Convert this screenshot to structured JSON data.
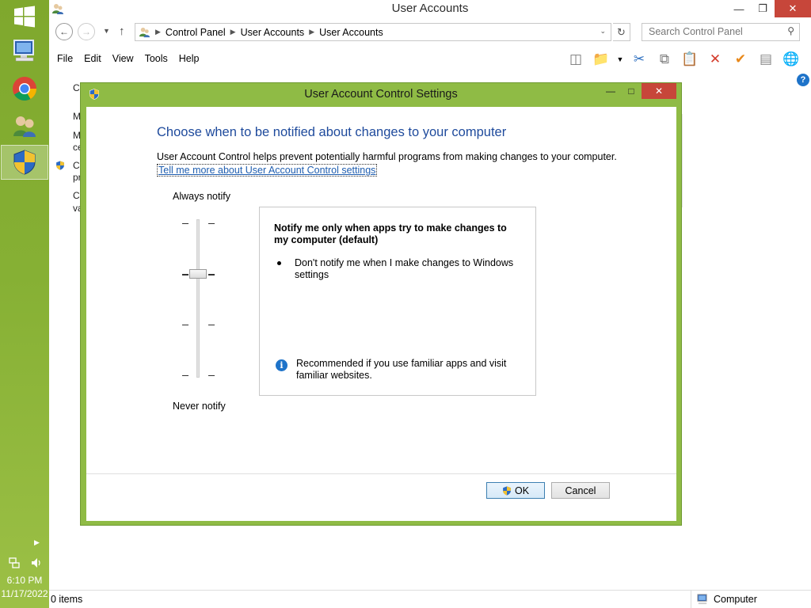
{
  "taskbar": {
    "time": "6:10 PM",
    "date": "11/17/2022",
    "pinned": [
      "computer-icon",
      "chrome-icon",
      "user-accounts-icon",
      "uac-shield-icon"
    ]
  },
  "explorer": {
    "title": "User Accounts",
    "breadcrumb": [
      "Control Panel",
      "User Accounts",
      "User Accounts"
    ],
    "search_placeholder": "Search Control Panel",
    "menu": [
      "File",
      "Edit",
      "View",
      "Tools",
      "Help"
    ],
    "background_fragments": [
      "C",
      "M",
      "M",
      "ce",
      "C",
      "pr",
      "Cl",
      "va"
    ],
    "status_items": "0 items",
    "status_location": "Computer"
  },
  "uac": {
    "title": "User Account Control Settings",
    "heading": "Choose when to be notified about changes to your computer",
    "description": "User Account Control helps prevent potentially harmful programs from making changes to your computer.",
    "link": "Tell me more about User Account Control settings",
    "slider_top_label": "Always notify",
    "slider_bottom_label": "Never notify",
    "slider_level": 3,
    "slider_levels": 4,
    "panel_title": "Notify me only when apps try to make changes to my computer (default)",
    "panel_bullet": "Don't notify me when I make changes to Windows settings",
    "panel_recommendation": "Recommended if you use familiar apps and visit familiar websites.",
    "ok_label": "OK",
    "cancel_label": "Cancel"
  },
  "colors": {
    "taskbar_green": "#86b034",
    "dialog_frame": "#8fbb45",
    "heading_blue": "#1e4a9c",
    "close_red": "#c7463a"
  }
}
